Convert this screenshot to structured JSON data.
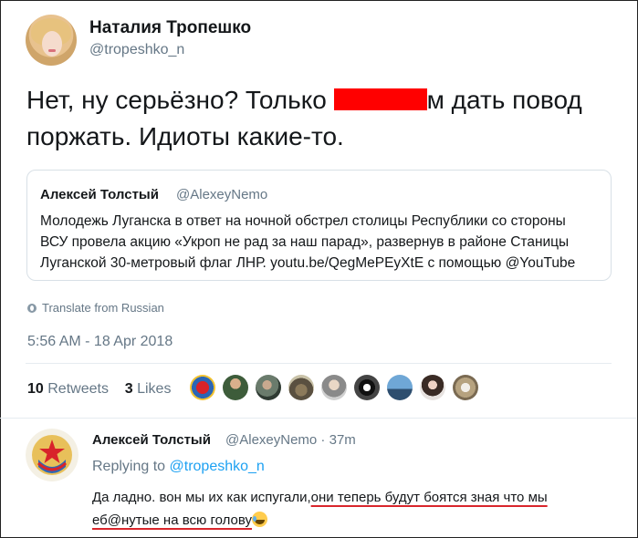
{
  "author": {
    "name": "Наталия Тропешко",
    "handle": "@tropeshko_n"
  },
  "tweet": {
    "text_before": "Нет, ну серьёзно? Только ",
    "text_after": "м дать повод поржать. Идиоты какие-то."
  },
  "quoted": {
    "name": "Алексей Толстый",
    "handle": "@AlexeyNemo",
    "text": "Молодежь Луганска в ответ на ночной обстрел столицы Республики со стороны\nВСУ провела акцию «Укроп не рад за наш парад», развернув в районе Станицы\nЛуганской 30-метровый флаг ЛНР. youtu.be/QegMePEyXtE с помощью @YouTube"
  },
  "translate_label": "Translate from Russian",
  "timestamp": "5:56 AM - 18 Apr 2018",
  "stats": {
    "retweets_count": "10",
    "retweets_label": "Retweets",
    "likes_count": "3",
    "likes_label": "Likes"
  },
  "reply": {
    "name": "Алексей Толстый",
    "handle": "@AlexeyNemo",
    "age": " · 37m",
    "replying_label": "Replying to ",
    "replying_handle": "@tropeshko_n",
    "text_plain": "Да ладно. вон мы их как испугали,",
    "text_underlined_1": "они теперь будут боятся зная что мы",
    "text_underlined_2": "еб@нутые на всю голову"
  },
  "colors": {
    "link": "#1da1f2",
    "muted": "#657786",
    "redaction": "#ff0000",
    "underline": "#d9262c"
  }
}
